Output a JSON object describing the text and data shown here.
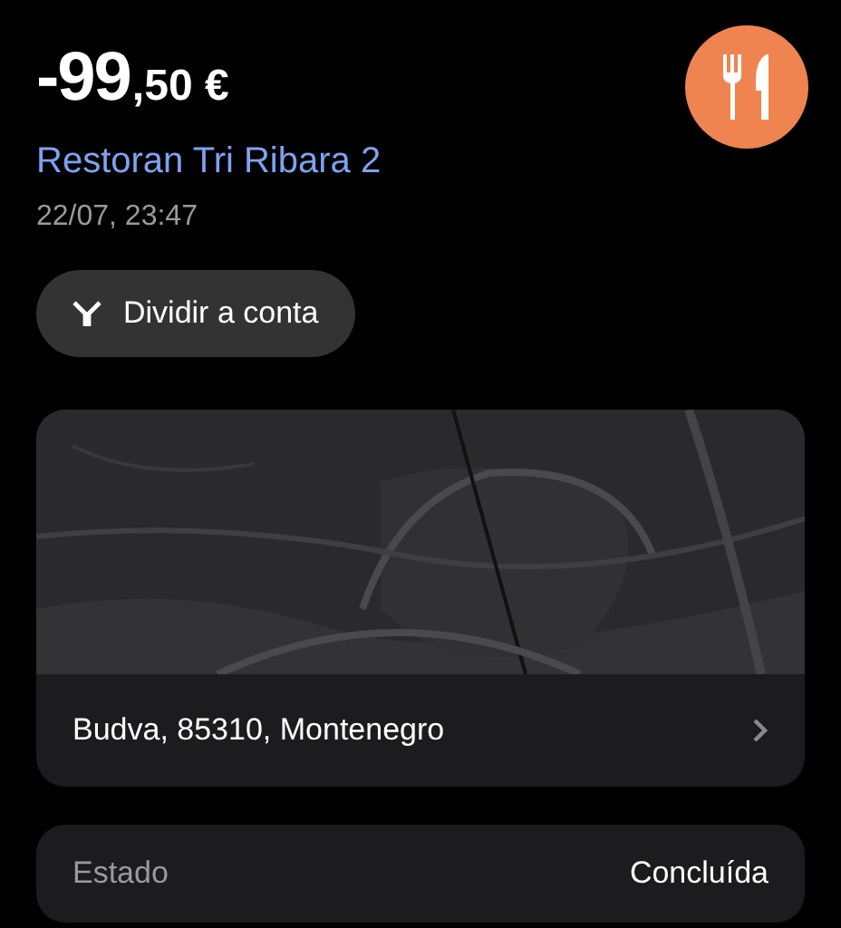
{
  "transaction": {
    "amount_whole": "-99",
    "amount_fraction": ",50 €",
    "merchant": "Restoran Tri Ribara 2",
    "datetime": "22/07, 23:47",
    "category": {
      "kind": "restaurant"
    }
  },
  "split_button": {
    "label": "Dividir a conta"
  },
  "location": {
    "address": "Budva, 85310, Montenegro"
  },
  "details": [
    {
      "label": "Estado",
      "value": "Concluída"
    }
  ]
}
